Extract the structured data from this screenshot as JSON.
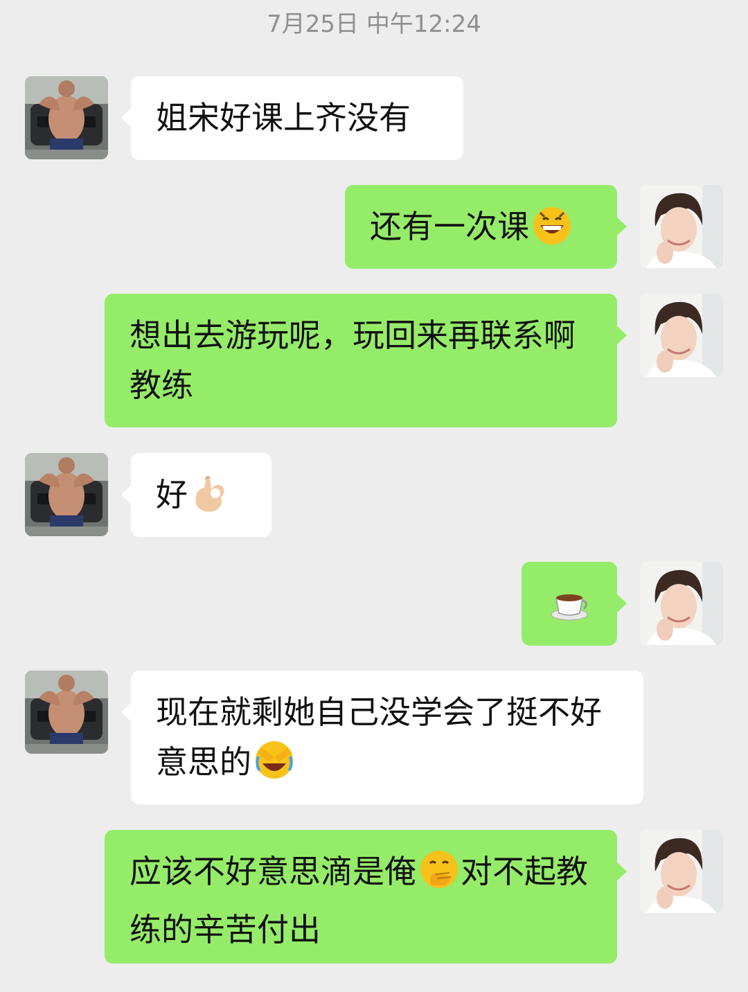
{
  "header": {
    "timestamp": "7月25日 中午12:24"
  },
  "participants": {
    "coach": {
      "avatar": "avatar-muscular-man-car",
      "side": "left"
    },
    "me": {
      "avatar": "avatar-woman-smiling",
      "side": "right"
    }
  },
  "messages": [
    {
      "from": "coach",
      "text": "姐宋好课上齐没有",
      "emoji": ""
    },
    {
      "from": "me",
      "text": "还有一次课",
      "emoji": "grin-emoji"
    },
    {
      "from": "me",
      "text": "想出去游玩呢，玩回来再联系啊教练",
      "emoji": ""
    },
    {
      "from": "coach",
      "text": "好",
      "emoji": "ok-hand-emoji"
    },
    {
      "from": "me",
      "text": "",
      "emoji": "coffee-emoji"
    },
    {
      "from": "coach",
      "text": "现在就剩她自己没学会了挺不好意思的",
      "emoji": "facepalm-laugh-emoji"
    },
    {
      "from": "me",
      "text_a": "应该不好意思滴是俺",
      "emoji": "thinking-hand-mouth-emoji",
      "text_b": "对不起教练的辛苦付出"
    }
  ],
  "colors": {
    "background": "#ededed",
    "incoming_bubble": "#ffffff",
    "outgoing_bubble": "#95ec69",
    "timestamp": "#8f8f8f"
  }
}
